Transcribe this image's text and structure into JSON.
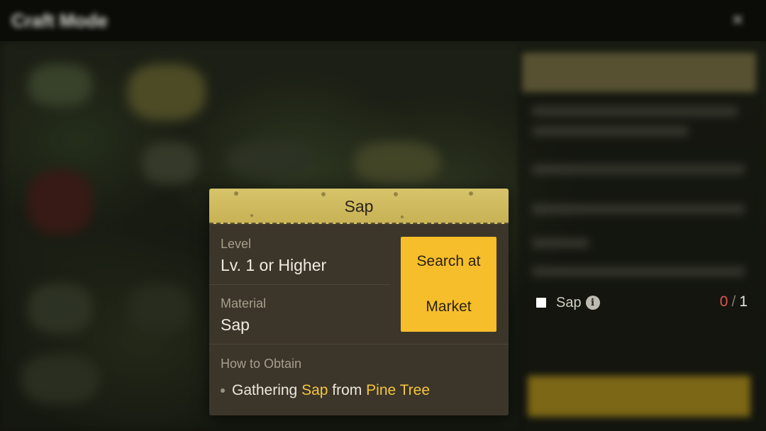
{
  "background": {
    "window_title": "Craft Mode",
    "close_glyph": "×"
  },
  "requirement": {
    "item_name": "Sap",
    "have": "0",
    "separator": "/",
    "need": "1"
  },
  "popup": {
    "title": "Sap",
    "level_label": "Level",
    "level_value": "Lv. 1 or Higher",
    "material_label": "Material",
    "material_value": "Sap",
    "market_button": {
      "line1": "Search at",
      "line2": "Market"
    },
    "obtain_label": "How to Obtain",
    "obtain": {
      "action": "Gathering",
      "item": "Sap",
      "connector": "from",
      "source": "Pine Tree"
    }
  },
  "colors": {
    "header_gold": "#d7c36a",
    "button_yellow": "#f6be2a",
    "highlight": "#f4c63d",
    "missing_red": "#e0584f"
  },
  "icons": {
    "info": "info-icon",
    "checkbox": "checkbox-icon"
  }
}
